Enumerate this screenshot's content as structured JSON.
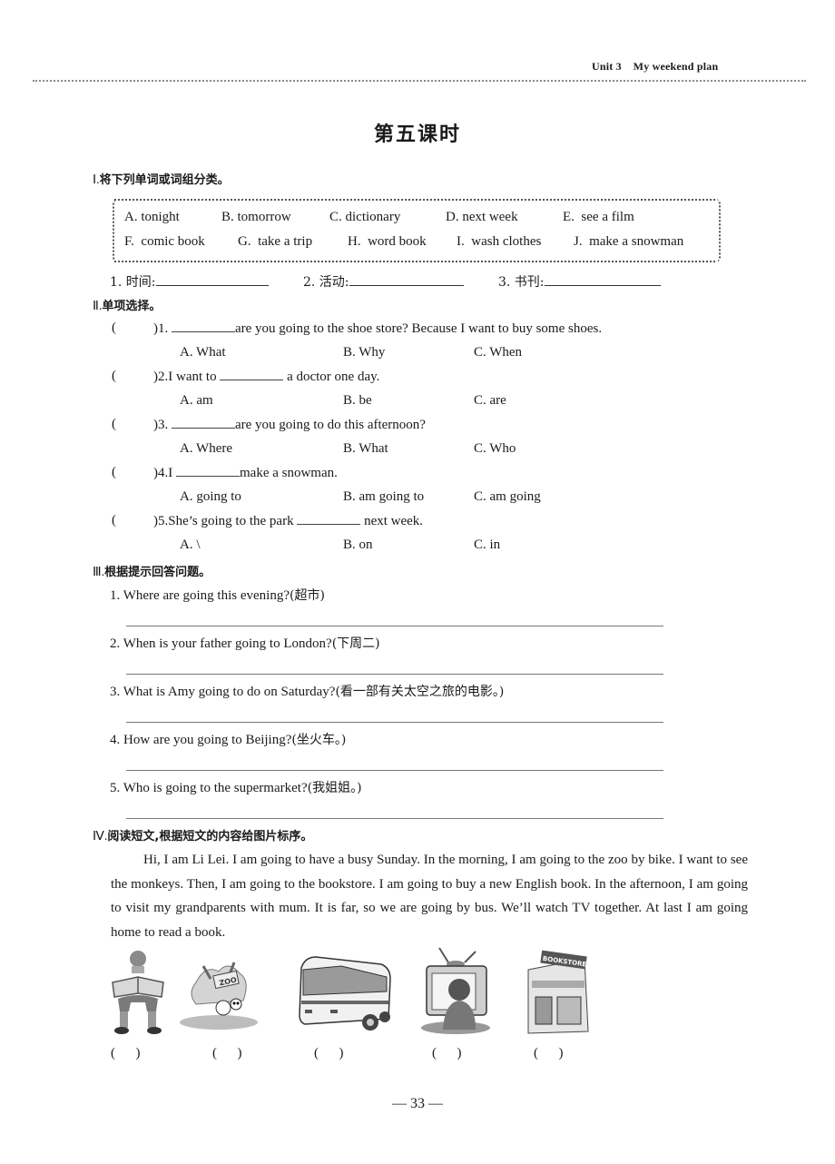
{
  "header": {
    "unit_label": "Unit 3    My weekend plan"
  },
  "lesson_title": "第五课时",
  "section1": {
    "number": "Ⅰ.",
    "title": "将下列单词或词组分类。",
    "words_row1": [
      {
        "letter": "A.",
        "text": "tonight"
      },
      {
        "letter": "B.",
        "text": "tomorrow"
      },
      {
        "letter": "C.",
        "text": "dictionary"
      },
      {
        "letter": "D.",
        "text": "next week"
      },
      {
        "letter": "E.",
        "text": "see a film"
      }
    ],
    "words_row2": [
      {
        "letter": "F.",
        "text": "comic book"
      },
      {
        "letter": "G.",
        "text": "take a trip"
      },
      {
        "letter": "H.",
        "text": "word book"
      },
      {
        "letter": "I.",
        "text": "wash clothes"
      },
      {
        "letter": "J.",
        "text": "make a snowman"
      }
    ],
    "categories": [
      {
        "label": "1. 时间:",
        "value": ""
      },
      {
        "label": "2. 活动:",
        "value": ""
      },
      {
        "label": "3. 书刊:",
        "value": ""
      }
    ]
  },
  "section2": {
    "number": "Ⅱ.",
    "title": "单项选择。",
    "questions": [
      {
        "num": ")1.",
        "before": "",
        "after": "are you going to the shoe store? Because I want to buy some shoes.",
        "answer": "",
        "options": [
          "A. What",
          "B. Why",
          "C. When"
        ]
      },
      {
        "num": ")2.",
        "before": "I want to",
        "after": " a doctor one day.",
        "answer": "",
        "options": [
          "A. am",
          "B. be",
          "C. are"
        ]
      },
      {
        "num": ")3.",
        "before": "",
        "after": "are you going to do this afternoon?",
        "answer": "",
        "options": [
          "A. Where",
          "B. What",
          "C. Who"
        ]
      },
      {
        "num": ")4.",
        "before": "I",
        "after": "make a snowman.",
        "answer": "",
        "options": [
          "A. going to",
          "B. am going to",
          "C. am going"
        ]
      },
      {
        "num": ")5.",
        "before": "She’s going to the park",
        "after": " next week.",
        "answer": "",
        "options": [
          "A. \\",
          "B. on",
          "C. in"
        ]
      }
    ]
  },
  "section3": {
    "number": "Ⅲ.",
    "title": "根据提示回答问题。",
    "questions": [
      {
        "q": "1. Where are going this evening?",
        "hint": "(超市)",
        "answer": ""
      },
      {
        "q": "2. When is your father going to London?",
        "hint": "(下周二)",
        "answer": ""
      },
      {
        "q": "3. What is Amy going to do on Saturday?",
        "hint": "(看一部有关太空之旅的电影。)",
        "answer": ""
      },
      {
        "q": "4. How are you going to Beijing?",
        "hint": "(坐火车。)",
        "answer": ""
      },
      {
        "q": "5. Who is going to the supermarket?",
        "hint": "(我姐姐。)",
        "answer": ""
      }
    ]
  },
  "section4": {
    "number": "Ⅳ.",
    "title": "阅读短文,根据短文的内容给图片标序。",
    "passage": "Hi, I am Li Lei. I am going to have a busy Sunday. In the morning, I am going to the zoo by bike. I want to see the monkeys. Then, I am going to the bookstore. I am going to buy a new English book. In the afternoon, I am going to visit my grandparents with mum. It is far, so we are going by bus. We’ll watch TV together. At last I am going home to read a book.",
    "pictures": [
      {
        "icon": "boy-reading-book-icon",
        "order": "(      )"
      },
      {
        "icon": "zoo-icon",
        "order": "(      )",
        "sign": "ZOO"
      },
      {
        "icon": "bus-icon",
        "order": "(      )"
      },
      {
        "icon": "child-watching-tv-icon",
        "order": "(      )"
      },
      {
        "icon": "bookstore-icon",
        "order": "(      )",
        "sign": "BOOKSTORE"
      }
    ]
  },
  "page_number": "— 33 —"
}
